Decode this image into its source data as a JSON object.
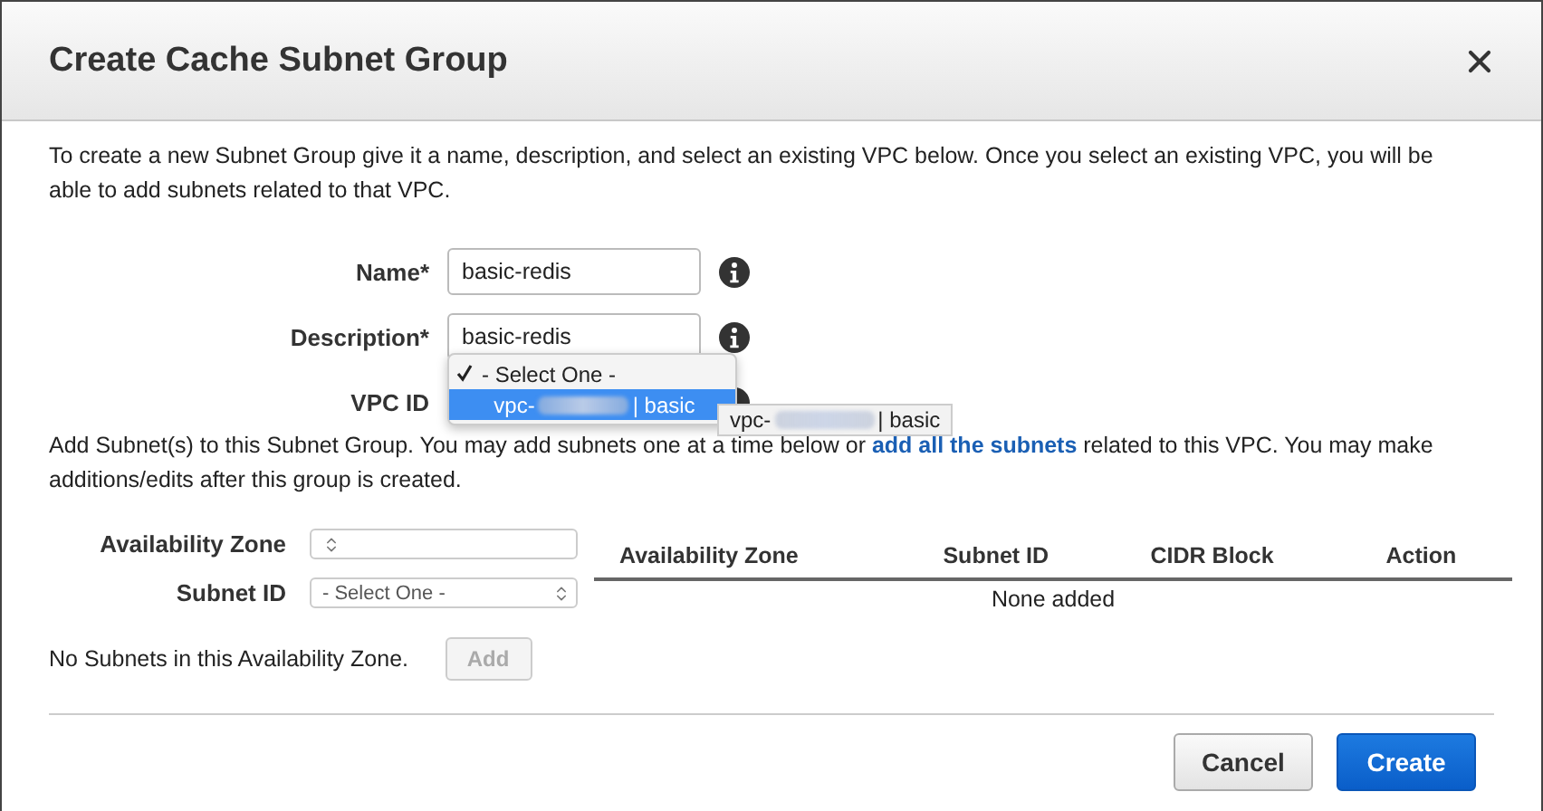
{
  "dialog": {
    "title": "Create Cache Subnet Group"
  },
  "intro": "To create a new Subnet Group give it a name, description, and select an existing VPC below. Once you select an existing VPC, you will be able to add subnets related to that VPC.",
  "fields": [
    {
      "label": "Name*",
      "value": "basic-redis"
    },
    {
      "label": "Description*",
      "value": "basic-redis"
    }
  ],
  "vpc": {
    "label": "VPC ID",
    "options": [
      {
        "prefix": "- Select One -",
        "checked": true,
        "highlighted": false
      },
      {
        "prefix": "vpc-",
        "suffix": "| basic",
        "checked": false,
        "highlighted": true
      }
    ],
    "tooltip": {
      "prefix": "vpc-",
      "suffix": "| basic"
    }
  },
  "subnet_note": {
    "text": "Add Subnet(s) to this Subnet Group. You may add subnets one at a time below or ",
    "link": "add all the subnets",
    "rest": " related to this VPC. You may make additions/edits after this group is created."
  },
  "zone_select": {
    "label": "Availability Zone"
  },
  "subnet_select": {
    "label": "Subnet ID",
    "value": "- Select One -"
  },
  "no_subnets": "No Subnets in this Availability Zone.",
  "add_button": {
    "label": "Add",
    "disabled": true
  },
  "table": {
    "columns": [
      "Availability Zone",
      "Subnet ID",
      "CIDR Block",
      "Action"
    ],
    "empty": "None added"
  },
  "buttons": [
    {
      "label": "Cancel",
      "kind": "secondary"
    },
    {
      "label": "Create",
      "kind": "primary"
    }
  ]
}
